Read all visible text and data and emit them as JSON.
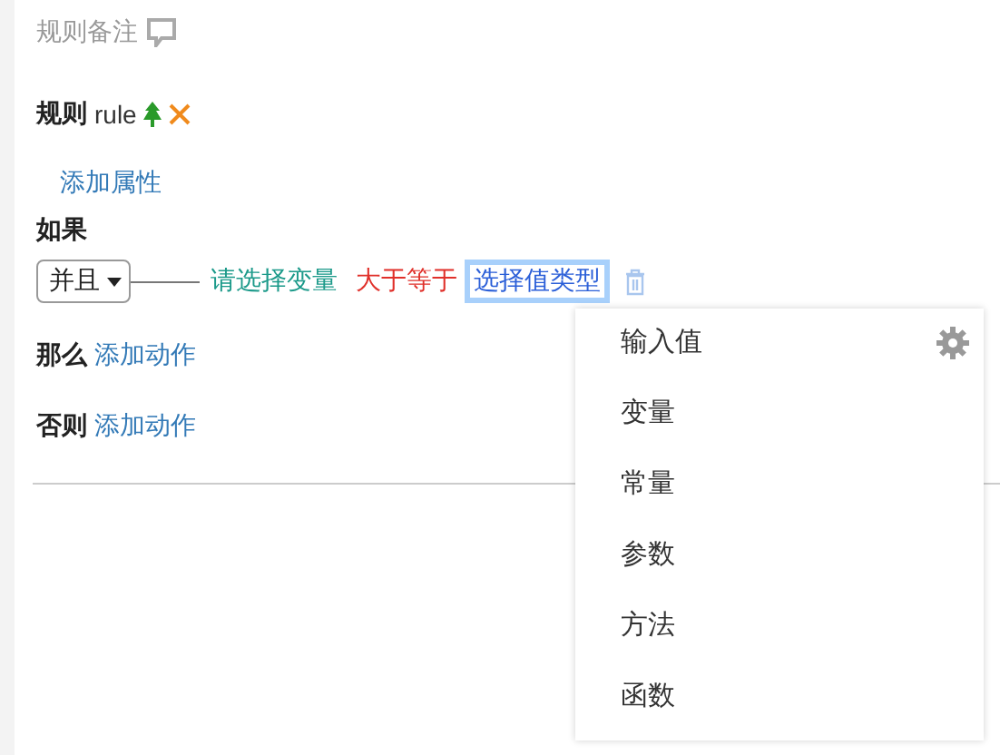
{
  "header": {
    "title": "规则备注"
  },
  "rule": {
    "label": "规则",
    "name": "rule"
  },
  "add_attribute": "添加属性",
  "if": {
    "label": "如果",
    "join": "并且",
    "variable": "请选择变量",
    "operator": "大于等于",
    "value_type": "选择值类型"
  },
  "then": {
    "label": "那么",
    "action": "添加动作"
  },
  "else": {
    "label": "否则",
    "action": "添加动作"
  },
  "menu": {
    "items": [
      {
        "label": "输入值"
      },
      {
        "label": "变量"
      },
      {
        "label": "常量"
      },
      {
        "label": "参数"
      },
      {
        "label": "方法"
      },
      {
        "label": "函数"
      }
    ]
  }
}
